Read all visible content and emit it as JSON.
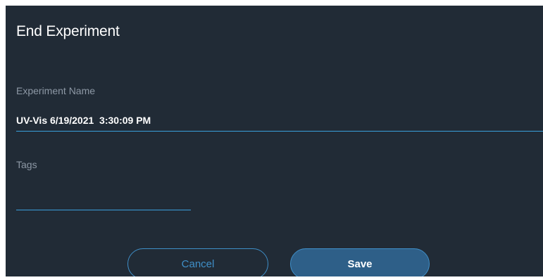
{
  "dialog": {
    "title": "End Experiment",
    "experiment_name_label": "Experiment Name",
    "experiment_name_value": "UV-Vis 6/19/2021  3:30:09 PM",
    "tags_label": "Tags",
    "tags_value": ""
  },
  "buttons": {
    "cancel_label": "Cancel",
    "save_label": "Save"
  },
  "colors": {
    "background": "#212b36",
    "accent": "#3aa0dc",
    "save_fill": "#2e5f88",
    "label_text": "#8d98a5"
  }
}
